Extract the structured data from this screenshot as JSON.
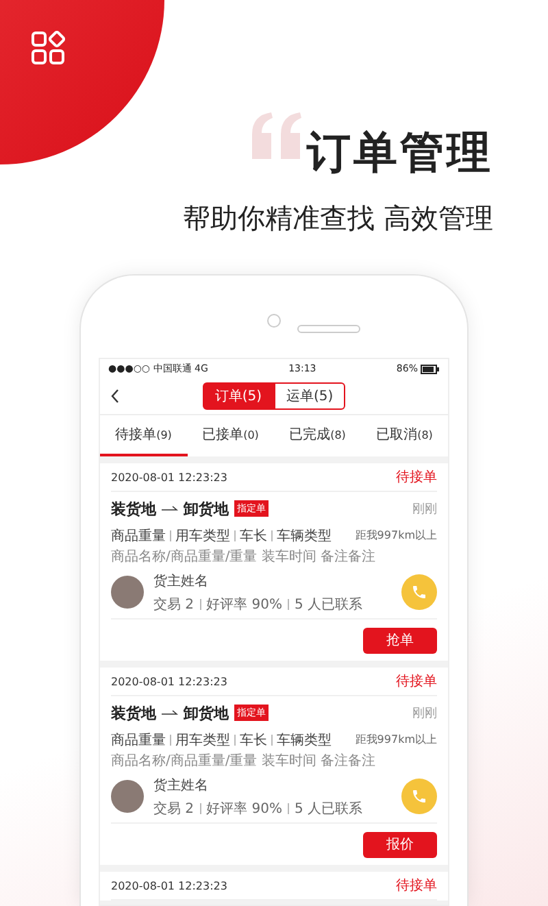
{
  "hero": {
    "title": "订单管理",
    "subtitle": "帮助你精准查找 高效管理"
  },
  "status_bar": {
    "carrier": "●●●○○ 中国联通",
    "network": "4G",
    "time": "13:13",
    "battery": "86%"
  },
  "segments": [
    {
      "label": "订单(5)",
      "selected": true
    },
    {
      "label": "运单(5)",
      "selected": false
    }
  ],
  "tabs": [
    {
      "label": "待接单",
      "count": "(9)",
      "selected": true
    },
    {
      "label": "已接单",
      "count": "(0)",
      "selected": false
    },
    {
      "label": "已完成",
      "count": "(8)",
      "selected": false
    },
    {
      "label": "已取消",
      "count": "(8)",
      "selected": false
    }
  ],
  "orders": [
    {
      "kind": "full",
      "time": "2020-08-01 12:23:23",
      "status": "待接单",
      "from": "装货地",
      "to": "卸货地",
      "badge": "指定单",
      "when": "刚刚",
      "specs": [
        "商品重量",
        "用车类型",
        "车长",
        "车辆类型"
      ],
      "distance": "距我997km以上",
      "desc": "商品名称/商品重量/重量  装车时间  备注备注",
      "owner": "货主姓名",
      "stats": [
        "交易 2",
        "好评率 90%",
        "5 人已联系"
      ],
      "action": "抢单"
    },
    {
      "kind": "full",
      "time": "2020-08-01 12:23:23",
      "status": "待接单",
      "from": "装货地",
      "to": "卸货地",
      "badge": "指定单",
      "when": "刚刚",
      "specs": [
        "商品重量",
        "用车类型",
        "车长",
        "车辆类型"
      ],
      "distance": "距我997km以上",
      "desc": "商品名称/商品重量/重量  装车时间  备注备注",
      "owner": "货主姓名",
      "stats": [
        "交易 2",
        "好评率 90%",
        "5 人已联系"
      ],
      "action": "报价"
    },
    {
      "kind": "header",
      "time": "2020-08-01 12:23:23",
      "status": "待接单"
    }
  ]
}
